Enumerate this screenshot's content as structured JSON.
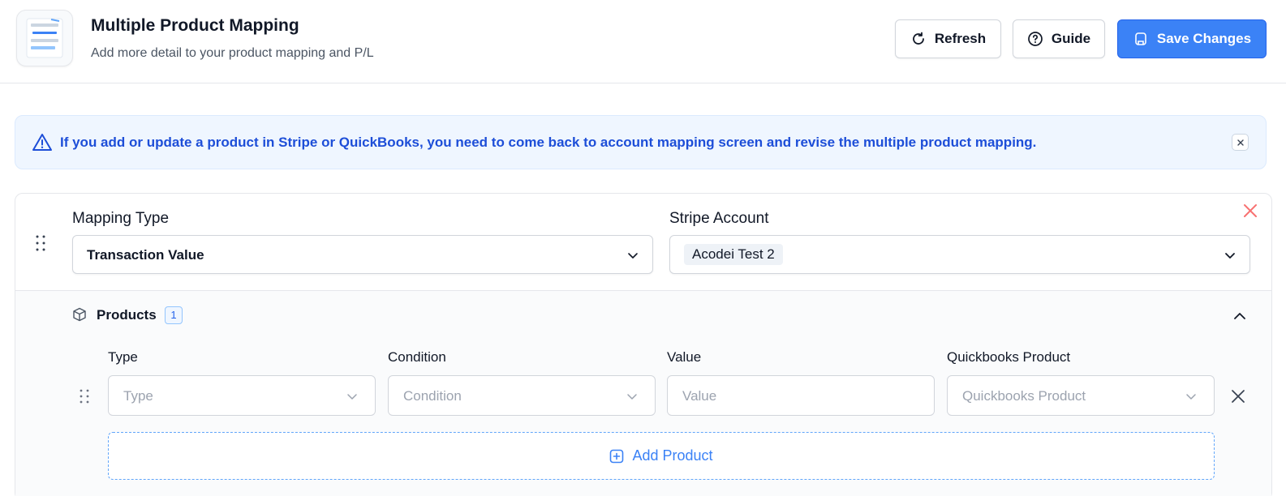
{
  "header": {
    "title": "Multiple Product Mapping",
    "subtitle": "Add more detail to your product mapping and P/L",
    "buttons": {
      "refresh": "Refresh",
      "guide": "Guide",
      "save": "Save Changes"
    }
  },
  "alert": {
    "text": "If you add or update a product in Stripe or QuickBooks, you need to come back to account mapping screen and revise the multiple product mapping.",
    "icon": "warning-triangle-icon"
  },
  "mapping": {
    "mapping_type_label": "Mapping Type",
    "mapping_type_value": "Transaction Value",
    "stripe_account_label": "Stripe Account",
    "stripe_account_value": "Acodei Test 2",
    "products": {
      "title": "Products",
      "count": "1",
      "columns": {
        "type": "Type",
        "condition": "Condition",
        "value": "Value",
        "quickbooks_product": "Quickbooks Product"
      },
      "row": {
        "type_placeholder": "Type",
        "condition_placeholder": "Condition",
        "value_placeholder": "Value",
        "quickbooks_placeholder": "Quickbooks Product"
      },
      "add_label": "Add Product"
    }
  },
  "colors": {
    "primary": "#3b82f6",
    "alert_bg": "#eff6ff",
    "alert_text": "#1d4ed8",
    "danger": "#ef4444"
  }
}
